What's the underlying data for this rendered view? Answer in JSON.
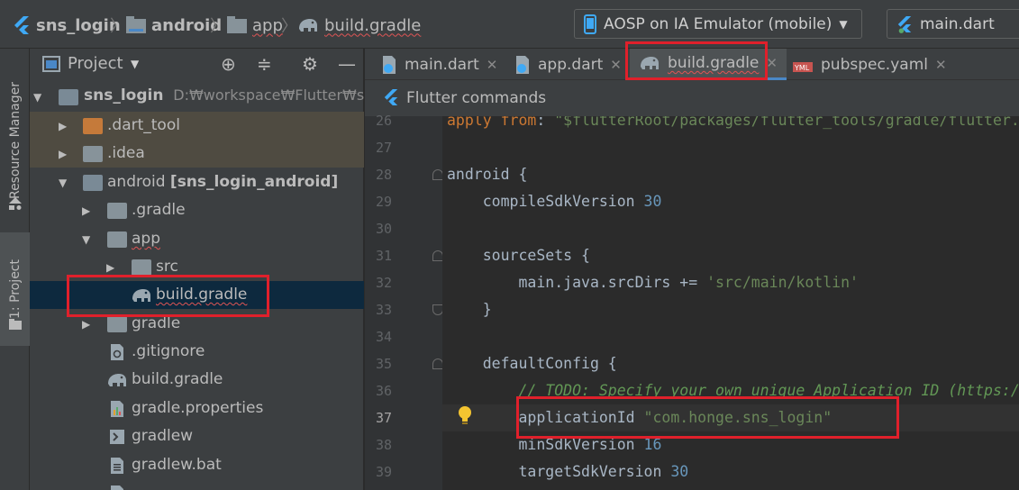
{
  "breadcrumb": {
    "project": "sns_login",
    "module": "android",
    "folder": "app",
    "file": "build.gradle"
  },
  "toolbar": {
    "device_selector": "AOSP on IA Emulator (mobile)",
    "run_config": "main.dart"
  },
  "side_tabs": {
    "resource_manager": "Resource Manager",
    "project": "1: Project"
  },
  "project_panel": {
    "view_selector": "Project",
    "tree": [
      {
        "label": "sns_login",
        "path": "D:₩workspace₩Flutter₩sns_",
        "kind": "root"
      },
      {
        "label": ".dart_tool",
        "kind": "folder-orange"
      },
      {
        "label": ".idea",
        "kind": "folder"
      },
      {
        "label": "android",
        "suffix": "[sns_login_android]",
        "kind": "module"
      },
      {
        "label": ".gradle",
        "kind": "folder"
      },
      {
        "label": "app",
        "kind": "folder"
      },
      {
        "label": "src",
        "kind": "folder"
      },
      {
        "label": "build.gradle",
        "kind": "gradle-file"
      },
      {
        "label": "gradle",
        "kind": "folder"
      },
      {
        "label": ".gitignore",
        "kind": "file"
      },
      {
        "label": "build.gradle",
        "kind": "gradle-file"
      },
      {
        "label": "gradle.properties",
        "kind": "properties-file"
      },
      {
        "label": "gradlew",
        "kind": "script-file"
      },
      {
        "label": "gradlew.bat",
        "kind": "file"
      }
    ]
  },
  "editor": {
    "tabs": [
      {
        "label": "main.dart",
        "icon": "dart-file-icon"
      },
      {
        "label": "app.dart",
        "icon": "dart-file-icon"
      },
      {
        "label": "build.gradle",
        "icon": "gradle-elephant-icon",
        "active": true
      },
      {
        "label": "pubspec.yaml",
        "icon": "yaml-file-icon"
      }
    ],
    "commands_bar": "Flutter commands",
    "current_line": 37,
    "lines": [
      {
        "n": "26",
        "parts": [
          [
            "kw",
            "apply"
          ],
          [
            "plain",
            " "
          ],
          [
            "kw",
            "from"
          ],
          [
            "plain",
            ": "
          ],
          [
            "str",
            "\"$flutterRoot/packages/flutter_tools/gradle/flutter.gradle\""
          ]
        ]
      },
      {
        "n": "27",
        "parts": []
      },
      {
        "n": "28",
        "parts": [
          [
            "plain",
            "android {"
          ]
        ]
      },
      {
        "n": "29",
        "parts": [
          [
            "plain",
            "    compileSdkVersion "
          ],
          [
            "num",
            "30"
          ]
        ]
      },
      {
        "n": "30",
        "parts": []
      },
      {
        "n": "31",
        "parts": [
          [
            "plain",
            "    sourceSets {"
          ]
        ]
      },
      {
        "n": "32",
        "parts": [
          [
            "plain",
            "        main.java.srcDirs += "
          ],
          [
            "str",
            "'src/main/kotlin'"
          ]
        ]
      },
      {
        "n": "33",
        "parts": [
          [
            "plain",
            "    }"
          ]
        ]
      },
      {
        "n": "34",
        "parts": []
      },
      {
        "n": "35",
        "parts": [
          [
            "plain",
            "    defaultConfig {"
          ]
        ]
      },
      {
        "n": "36",
        "parts": [
          [
            "cmt",
            "        // TODO: Specify your own unique Application ID (https://developer.android.com"
          ]
        ]
      },
      {
        "n": "37",
        "parts": [
          [
            "plain",
            "        applicationId "
          ],
          [
            "str",
            "\"com.honge.sns_login\""
          ]
        ]
      },
      {
        "n": "38",
        "parts": [
          [
            "plain",
            "        minSdkVersion "
          ],
          [
            "num",
            "16"
          ]
        ]
      },
      {
        "n": "39",
        "parts": [
          [
            "plain",
            "        targetSdkVersion "
          ],
          [
            "num",
            "30"
          ]
        ]
      }
    ]
  },
  "colors": {
    "annotation_red": "#e0202b",
    "flutter_blue": "#3fa9f5",
    "selection": "#0d293e"
  }
}
